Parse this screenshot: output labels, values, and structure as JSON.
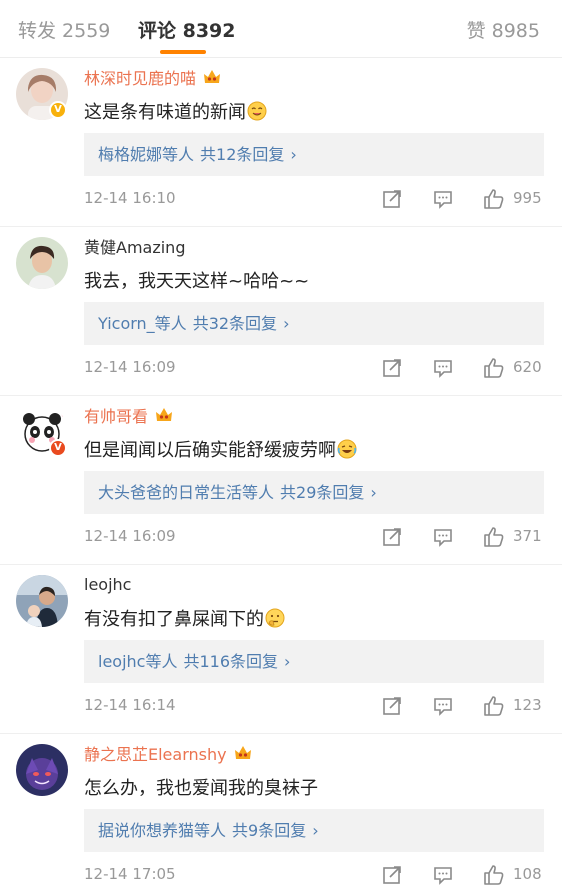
{
  "tabs": {
    "repost": "转发 2559",
    "comments": "评论 8392",
    "likes": "赞 8985"
  },
  "accent_color": "#ff8200",
  "link_color": "#507daf",
  "vip_name_color": "#eb7350",
  "comments": [
    {
      "username": "林深时见鹿的喵",
      "text": "这是条有味道的新闻",
      "text_emoji": "drool-face-emoji",
      "replies": {
        "names": "梅格妮娜",
        "suffix": "等人",
        "count": "共12条回复"
      },
      "time": "12-14 16:10",
      "likes": "995"
    },
    {
      "username": "黄健Amazing",
      "text": "我去，我天天这样~哈哈~~",
      "replies": {
        "names": "Yicorn_",
        "suffix": "等人",
        "count": "共32条回复"
      },
      "time": "12-14 16:09",
      "likes": "620"
    },
    {
      "username": "有帅哥看",
      "text": "但是闻闻以后确实能舒缓疲劳啊",
      "text_emoji": "laugh-tears-emoji",
      "replies": {
        "names": "大头爸爸的日常生活",
        "suffix": "等人",
        "count": "共29条回复"
      },
      "time": "12-14 16:09",
      "likes": "371"
    },
    {
      "username": "leojhc",
      "text": "有没有扣了鼻屎闻下的",
      "text_emoji": "thinking-face-emoji",
      "replies": {
        "names": "leojhc",
        "suffix": "等人",
        "count": "共116条回复"
      },
      "time": "12-14 16:14",
      "likes": "123"
    },
    {
      "username": "静之思芷Elearnshy",
      "text": "怎么办，我也爱闻我的臭袜子",
      "replies": {
        "names": "据说你想养猫",
        "suffix": "等人",
        "count": "共9条回复"
      },
      "time": "12-14 17:05",
      "likes": "108"
    }
  ]
}
